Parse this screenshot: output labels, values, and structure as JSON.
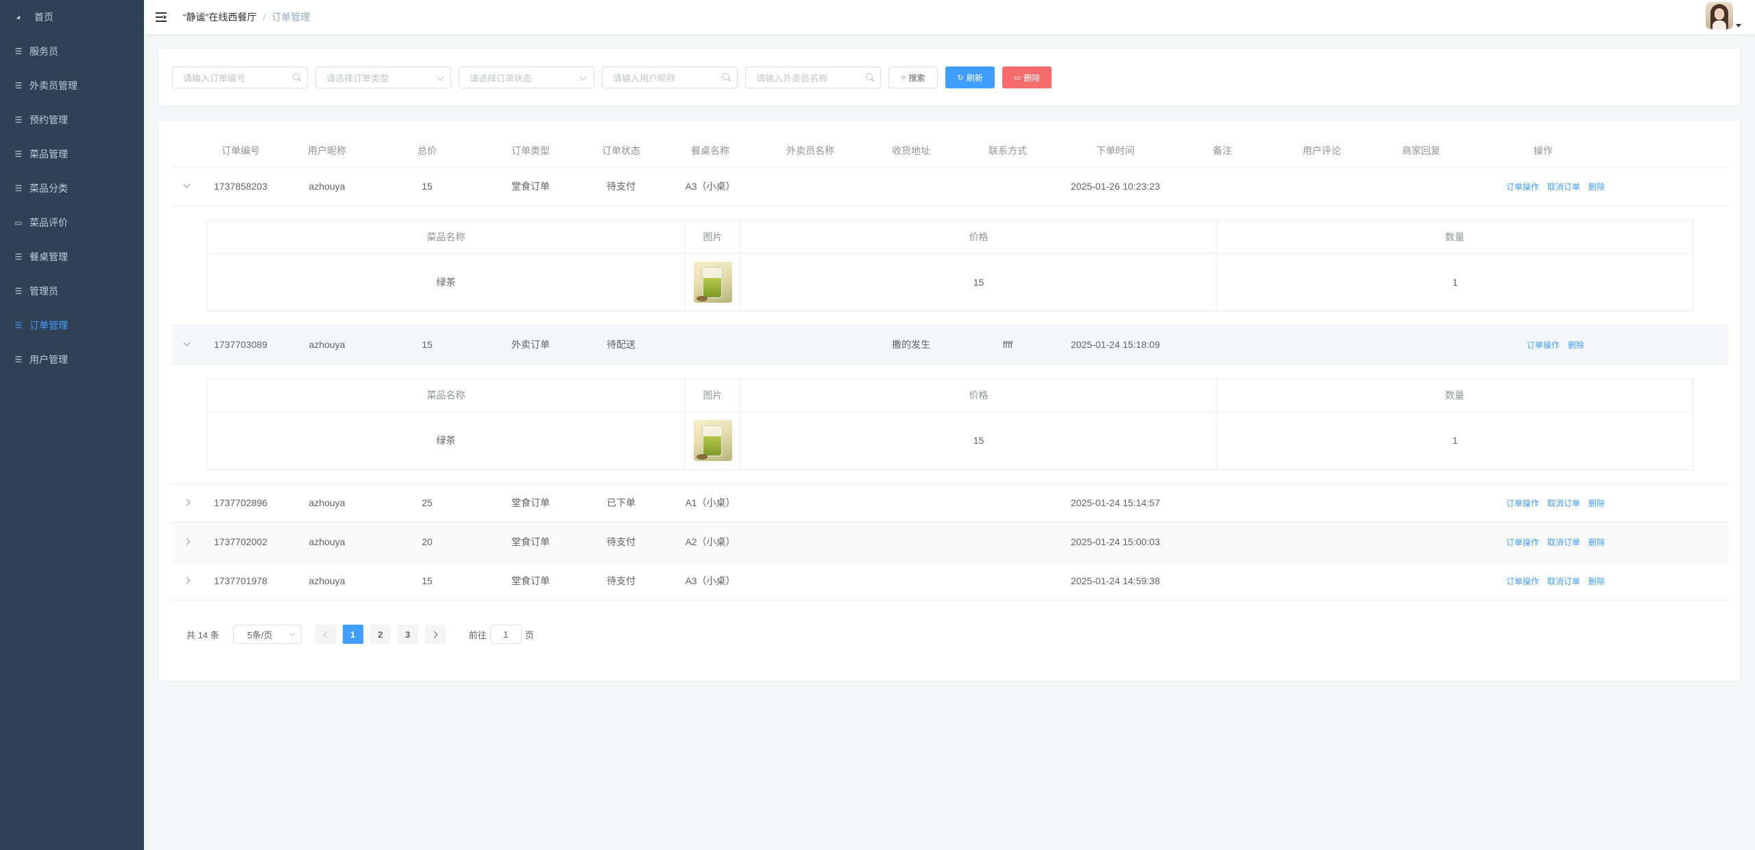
{
  "sidebar": {
    "items": [
      {
        "label": "首页",
        "icon": "dashboard-icon"
      },
      {
        "label": "服务员",
        "icon": "sliders-icon"
      },
      {
        "label": "外卖员管理",
        "icon": "sliders-icon"
      },
      {
        "label": "预约管理",
        "icon": "sliders-icon"
      },
      {
        "label": "菜品管理",
        "icon": "sliders-icon"
      },
      {
        "label": "菜品分类",
        "icon": "sliders-icon"
      },
      {
        "label": "菜品评价",
        "icon": "comment-icon"
      },
      {
        "label": "餐桌管理",
        "icon": "sliders-icon"
      },
      {
        "label": "管理员",
        "icon": "sliders-icon"
      },
      {
        "label": "订单管理",
        "icon": "sliders-icon",
        "active": true
      },
      {
        "label": "用户管理",
        "icon": "sliders-icon"
      }
    ]
  },
  "navbar": {
    "breadcrumb": [
      "“静谧”在线西餐厅",
      "订单管理"
    ],
    "separator": "/"
  },
  "search": {
    "order_no_placeholder": "请输入订单编号",
    "order_type_placeholder": "请选择订单类型",
    "order_status_placeholder": "请选择订单状态",
    "user_nick_placeholder": "请输入用户昵称",
    "courier_placeholder": "请输入外卖员名称",
    "search_label": "搜索",
    "refresh_label": "刷新",
    "delete_label": "删除"
  },
  "table": {
    "headers": [
      "订单编号",
      "用户昵称",
      "总价",
      "订单类型",
      "订单状态",
      "餐桌名称",
      "外卖员名称",
      "收货地址",
      "联系方式",
      "下单时间",
      "备注",
      "用户评论",
      "商家回复",
      "操作"
    ],
    "rows": [
      {
        "order_no": "1737858203",
        "user": "azhouya",
        "total": "15",
        "type": "堂食订单",
        "status": "待支付",
        "table_name": "A3（小桌）",
        "courier": "",
        "address": "",
        "contact": "",
        "time": "2025-01-26 10:23:23",
        "remark": "",
        "comment": "",
        "reply": "",
        "ops": [
          "订单操作",
          "取消订单",
          "删除"
        ],
        "expanded": true,
        "items": [
          {
            "name": "绿茶",
            "price": "15",
            "qty": "1"
          }
        ]
      },
      {
        "order_no": "1737703089",
        "user": "azhouya",
        "total": "15",
        "type": "外卖订单",
        "status": "待配送",
        "table_name": "",
        "courier": "",
        "address": "撒的发生",
        "contact": "ffff",
        "time": "2025-01-24 15:18:09",
        "remark": "",
        "comment": "",
        "reply": "",
        "ops": [
          "订单操作",
          "删除"
        ],
        "expanded": true,
        "items": [
          {
            "name": "绿茶",
            "price": "15",
            "qty": "1"
          }
        ]
      },
      {
        "order_no": "1737702896",
        "user": "azhouya",
        "total": "25",
        "type": "堂食订单",
        "status": "已下单",
        "table_name": "A1（小桌）",
        "courier": "",
        "address": "",
        "contact": "",
        "time": "2025-01-24 15:14:57",
        "remark": "",
        "comment": "",
        "reply": "",
        "ops": [
          "订单操作",
          "取消订单",
          "删除"
        ],
        "expanded": false
      },
      {
        "order_no": "1737702002",
        "user": "azhouya",
        "total": "20",
        "type": "堂食订单",
        "status": "待支付",
        "table_name": "A2（小桌）",
        "courier": "",
        "address": "",
        "contact": "",
        "time": "2025-01-24 15:00:03",
        "remark": "",
        "comment": "",
        "reply": "",
        "ops": [
          "订单操作",
          "取消订单",
          "删除"
        ],
        "expanded": false
      },
      {
        "order_no": "1737701978",
        "user": "azhouya",
        "total": "15",
        "type": "堂食订单",
        "status": "待支付",
        "table_name": "A3（小桌）",
        "courier": "",
        "address": "",
        "contact": "",
        "time": "2025-01-24 14:59:38",
        "remark": "",
        "comment": "",
        "reply": "",
        "ops": [
          "订单操作",
          "取消订单",
          "删除"
        ],
        "expanded": false
      }
    ]
  },
  "sub_table": {
    "headers": [
      "菜品名称",
      "图片",
      "价格",
      "数量"
    ]
  },
  "pagination": {
    "total_label": "共 14 条",
    "page_size": "5条/页",
    "pages": [
      "1",
      "2",
      "3"
    ],
    "current": "1",
    "goto_prefix": "前往",
    "goto_value": "1",
    "goto_suffix": "页"
  },
  "colors": {
    "sidebar_bg": "#304156",
    "sidebar_text": "#bfcbd9",
    "accent": "#409eff",
    "danger": "#f56c6c"
  }
}
